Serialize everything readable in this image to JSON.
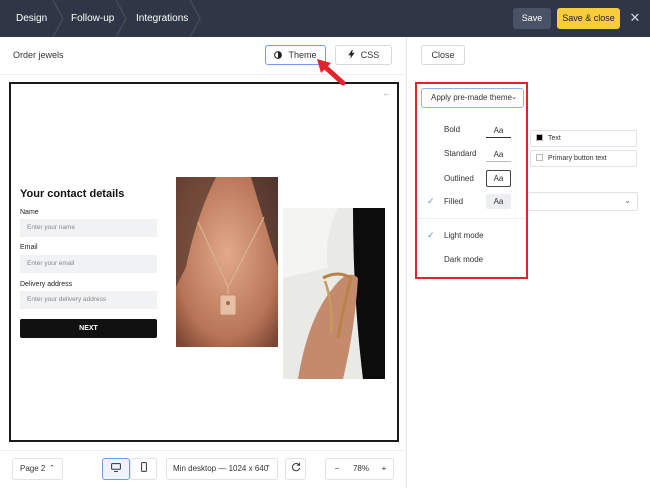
{
  "topbar": {
    "tabs": [
      {
        "label": "Design"
      },
      {
        "label": "Follow-up"
      },
      {
        "label": "Integrations"
      }
    ],
    "save_label": "Save",
    "save_close_label": "Save & close",
    "close_glyph": "✕"
  },
  "toolbar": {
    "doc_title": "Order jewels",
    "theme_label": "Theme",
    "css_label": "CSS",
    "close_label": "Close"
  },
  "form": {
    "title": "Your contact details",
    "fields": [
      {
        "label": "Name",
        "placeholder": "Enter your name"
      },
      {
        "label": "Email",
        "placeholder": "Enter your email"
      },
      {
        "label": "Delivery address",
        "placeholder": "Enter your delivery address"
      }
    ],
    "next_label": "NEXT"
  },
  "theme_menu": {
    "apply_label": "Apply pre-made theme",
    "styles": [
      {
        "label": "Bold",
        "preview": "Aa",
        "selected": false
      },
      {
        "label": "Standard",
        "preview": "Aa",
        "selected": false
      },
      {
        "label": "Outlined",
        "preview": "Aa",
        "selected": false
      },
      {
        "label": "Filled",
        "preview": "Aa",
        "selected": true
      }
    ],
    "modes": [
      {
        "label": "Light mode",
        "selected": true
      },
      {
        "label": "Dark mode",
        "selected": false
      }
    ]
  },
  "right_panel": {
    "text_color_label": "Text",
    "text_color": "#000000",
    "primary_button_text_label": "Primary button text",
    "primary_button_text_color": "#ffffff"
  },
  "bottombar": {
    "page_label": "Page 2",
    "size_label": "Min desktop — 1024 x 640",
    "zoom_value": "78%",
    "zoom_minus": "−",
    "zoom_plus": "+"
  },
  "colors": {
    "topbar_bg": "#2f3747",
    "save_close_bg": "#f8cd3c",
    "annotation_red": "#e0242a",
    "accent_blue": "#5b8ff0"
  },
  "icons": {
    "theme": "contrast-icon",
    "css": "lightning-icon",
    "desktop": "desktop-icon",
    "mobile": "mobile-icon",
    "rotate": "rotate-icon"
  }
}
